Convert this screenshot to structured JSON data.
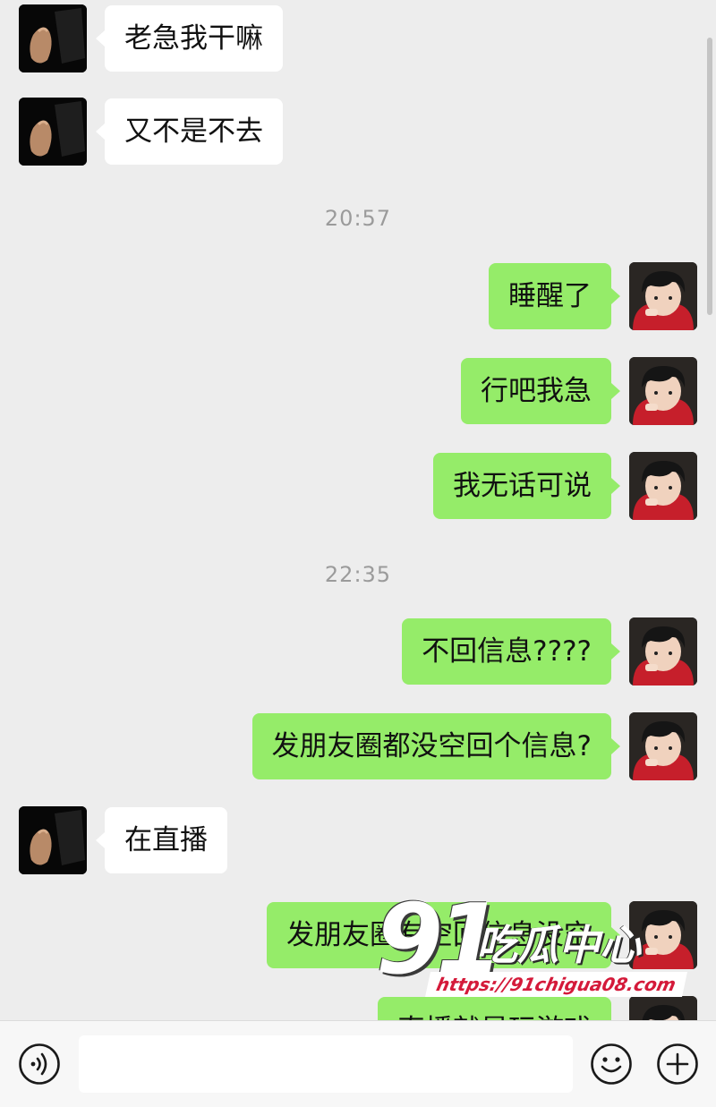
{
  "messages": [
    {
      "text": "老急我干嘛",
      "side": "in",
      "avatar": "dark-figure-avatar"
    },
    {
      "text": "又不是不去",
      "side": "in",
      "avatar": "dark-figure-avatar"
    },
    {
      "text": "睡醒了",
      "side": "out",
      "avatar": "boy-photo-avatar"
    },
    {
      "text": "行吧我急",
      "side": "out",
      "avatar": "boy-photo-avatar"
    },
    {
      "text": "我无话可说",
      "side": "out",
      "avatar": "boy-photo-avatar"
    },
    {
      "text": "不回信息????",
      "side": "out",
      "avatar": "boy-photo-avatar"
    },
    {
      "text": "发朋友圈都没空回个信息?",
      "side": "out",
      "avatar": "boy-photo-avatar"
    },
    {
      "text": "在直播",
      "side": "in",
      "avatar": "dark-figure-avatar"
    },
    {
      "text": "发朋友圈有空回信息没空",
      "side": "out",
      "avatar": "boy-photo-avatar"
    },
    {
      "text": "直播就是玩游戏",
      "side": "out",
      "avatar": "boy-photo-avatar"
    }
  ],
  "timestamps": [
    "20:57",
    "22:35"
  ],
  "watermark": {
    "number": "91",
    "brand": "吃瓜中心",
    "url": "https://91chigua08.com"
  },
  "input_bar": {
    "placeholder": "",
    "icons": [
      "voice-icon",
      "emoji-icon",
      "plus-icon"
    ]
  },
  "colors": {
    "background": "#ededed",
    "incoming_bubble": "#ffffff",
    "outgoing_bubble": "#95ec69",
    "timestamp_text": "#9b9b9b"
  }
}
